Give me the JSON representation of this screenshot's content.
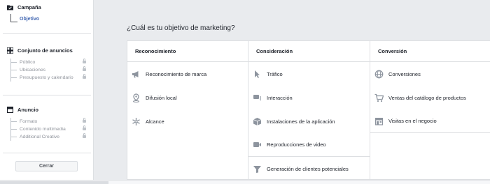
{
  "sidebar": {
    "campaign": {
      "title": "Campaña",
      "sub_item": "Objetivo"
    },
    "adset": {
      "title": "Conjunto de anuncios",
      "items": [
        "Público",
        "Ubicaciones",
        "Presupuesto y calendario"
      ]
    },
    "ad": {
      "title": "Anuncio",
      "items": [
        "Formato",
        "Contenido multimedia",
        "Additional Creative"
      ]
    },
    "close_label": "Cerrar"
  },
  "main": {
    "question": "¿Cuál es tu objetivo de marketing?",
    "columns": [
      {
        "heading": "Reconocimiento",
        "options": [
          {
            "label": "Reconocimiento de marca",
            "icon": "megaphone-icon"
          },
          {
            "label": "Difusión local",
            "icon": "location-pin-icon"
          },
          {
            "label": "Alcance",
            "icon": "asterisk-reach-icon"
          }
        ]
      },
      {
        "heading": "Consideración",
        "options": [
          {
            "label": "Tráfico",
            "icon": "cursor-icon"
          },
          {
            "label": "Interacción",
            "icon": "chat-bubbles-icon"
          },
          {
            "label": "Instalaciones de la aplicación",
            "icon": "cube-icon"
          },
          {
            "label": "Reproducciones de video",
            "icon": "video-camera-icon"
          },
          {
            "label": "Generación de clientes potenciales",
            "icon": "funnel-icon"
          }
        ]
      },
      {
        "heading": "Conversión",
        "options": [
          {
            "label": "Conversiones",
            "icon": "globe-icon"
          },
          {
            "label": "Ventas del catálogo de productos",
            "icon": "shopping-cart-icon"
          },
          {
            "label": "Visitas en el negocio",
            "icon": "store-icon"
          }
        ]
      }
    ]
  },
  "colors": {
    "accent": "#4267b2",
    "icon_gray": "#8d949e",
    "border": "#dddfe2",
    "background": "#e9ebee"
  }
}
